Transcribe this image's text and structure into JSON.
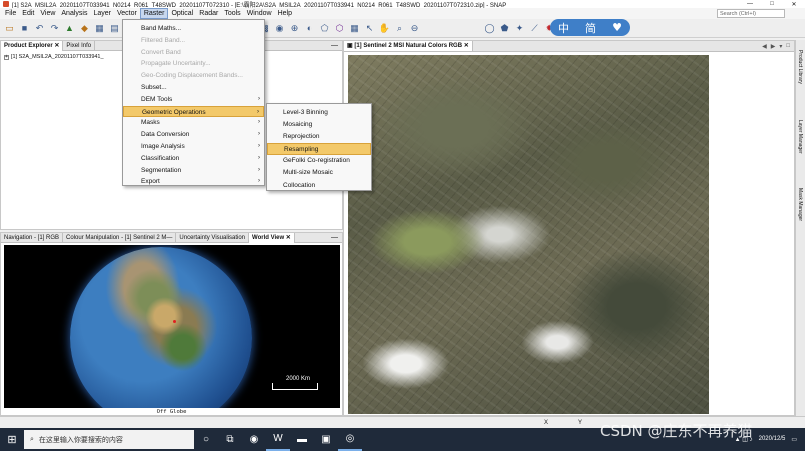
{
  "window": {
    "title": "[1] S2A_MSIL2A_20201107T033941_N0214_R061_T48SWD_20201107T072310 - [E:\\霸阳2A\\S2A_MSIL2A_20201107T033941_N0214_R061_T48SWD_20201107T072310.zip] - SNAP",
    "minimize": "—",
    "maximize": "□",
    "close": "✕"
  },
  "menubar": {
    "items": [
      "File",
      "Edit",
      "View",
      "Analysis",
      "Layer",
      "Vector",
      "Raster",
      "Optical",
      "Radar",
      "Tools",
      "Window",
      "Help"
    ],
    "search_placeholder": "Search (Ctrl+I)"
  },
  "ime": {
    "lang": "中",
    "mode": "简"
  },
  "product_explorer": {
    "tabs": [
      "Product Explorer",
      "Pixel Info"
    ],
    "tree_item": "[1] S2A_MSIL2A_20201107T033941_"
  },
  "raster_menu": {
    "items": [
      {
        "label": "Band Maths...",
        "enabled": true,
        "submenu": false
      },
      {
        "label": "Filtered Band...",
        "enabled": false,
        "submenu": false
      },
      {
        "label": "Convert Band",
        "enabled": false,
        "submenu": false
      },
      {
        "label": "Propagate Uncertainty...",
        "enabled": false,
        "submenu": false
      },
      {
        "label": "Geo-Coding Displacement Bands...",
        "enabled": false,
        "submenu": false
      },
      {
        "label": "Subset...",
        "enabled": true,
        "submenu": false
      },
      {
        "label": "DEM Tools",
        "enabled": true,
        "submenu": true
      },
      {
        "label": "Geometric Operations",
        "enabled": true,
        "submenu": true
      },
      {
        "label": "Masks",
        "enabled": true,
        "submenu": true
      },
      {
        "label": "Data Conversion",
        "enabled": true,
        "submenu": true
      },
      {
        "label": "Image Analysis",
        "enabled": true,
        "submenu": true
      },
      {
        "label": "Classification",
        "enabled": true,
        "submenu": true
      },
      {
        "label": "Segmentation",
        "enabled": true,
        "submenu": true
      },
      {
        "label": "Export",
        "enabled": true,
        "submenu": true
      }
    ],
    "highlighted": "Geometric Operations"
  },
  "geometric_submenu": {
    "items": [
      "Level-3 Binning",
      "Mosaicing",
      "Reprojection",
      "Resampling",
      "GeFolki Co-registration",
      "Multi-size Mosaic",
      "Collocation"
    ],
    "highlighted": "Resampling"
  },
  "bottom_panel": {
    "tabs": [
      "Navigation - [1] RGB",
      "Colour Manipulation - [1] Sentinel 2 M—",
      "Uncertainty Visualisation",
      "World View"
    ],
    "scale_label": "2000 Km",
    "status": "Off Globe"
  },
  "image_view": {
    "tab": "[1] Sentinel 2 MSI Natural Colors RGB"
  },
  "right_sidebar": {
    "tabs": [
      "Product Library",
      "Layer Manager",
      "Mask Manager"
    ]
  },
  "statusbar": {
    "x_label": "X",
    "y_label": "Y"
  },
  "taskbar": {
    "search_placeholder": "在这里输入你要搜索的内容",
    "date": "2020/12/5",
    "watermark": "CSDN @庄东不再养猫"
  }
}
